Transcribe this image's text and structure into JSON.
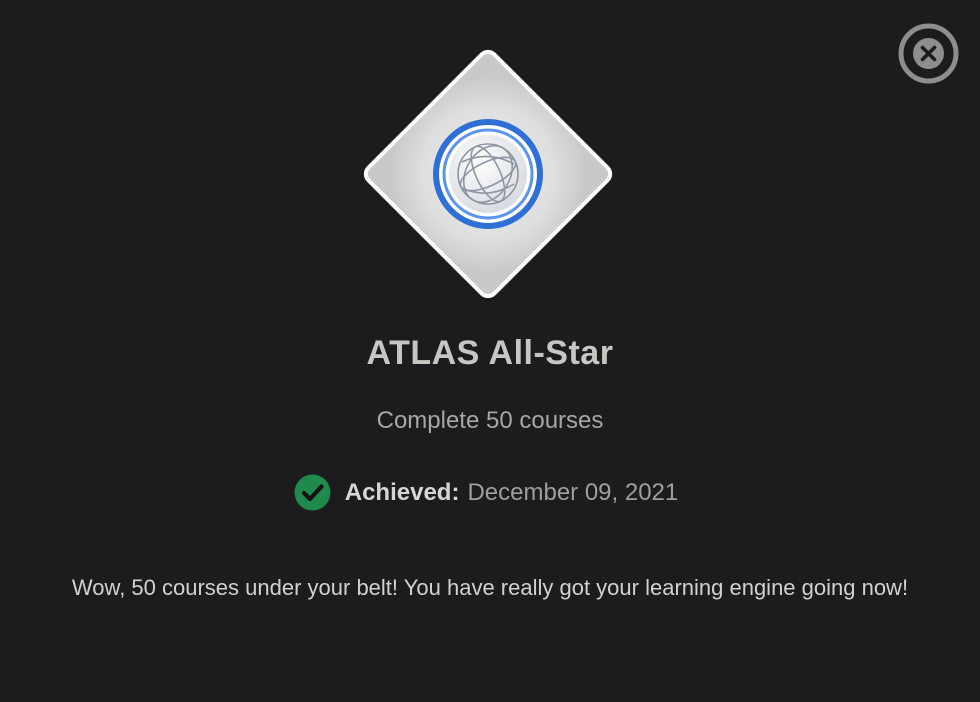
{
  "close_icon": "close-x-circle-icon",
  "badge": {
    "icon": "globe-icon",
    "shape": "diamond",
    "ring_color": "#2f6fd6",
    "tile_color": "#d9d9d9"
  },
  "title": "ATLAS All-Star",
  "requirement": "Complete 50 courses",
  "achieved": {
    "icon": "check-circle-icon",
    "icon_color": "#1f8a4c",
    "label": "Achieved:",
    "date": "December 09, 2021"
  },
  "description": "Wow, 50 courses under your belt! You have really got your learning engine going now!"
}
